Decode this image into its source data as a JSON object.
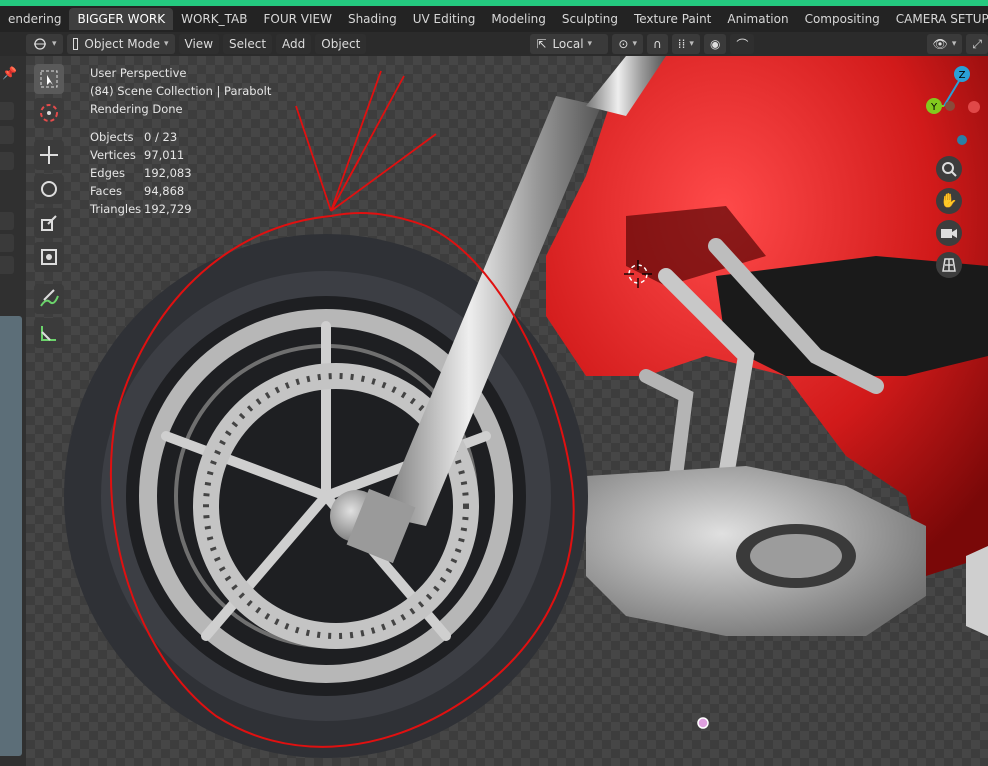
{
  "tabs": [
    "endering",
    "BIGGER WORK",
    "WORK_TAB",
    "FOUR VIEW",
    "Shading",
    "UV Editing",
    "Modeling",
    "Sculpting",
    "Texture Paint",
    "Animation",
    "Compositing",
    "CAMERA SETUP"
  ],
  "active_tab": "BIGGER WORK",
  "add_tab": "+",
  "header": {
    "mode": "Object Mode",
    "menus": [
      "View",
      "Select",
      "Add",
      "Object"
    ],
    "transform_orientation": "Local"
  },
  "viewport": {
    "view_name": "User Perspective",
    "collection": "(84) Scene Collection | Parabolt",
    "status": "Rendering Done",
    "stats": [
      {
        "label": "Objects",
        "value": "0 / 23"
      },
      {
        "label": "Vertices",
        "value": "97,011"
      },
      {
        "label": "Edges",
        "value": "192,083"
      },
      {
        "label": "Faces",
        "value": "94,868"
      },
      {
        "label": "Triangles",
        "value": "192,729"
      }
    ]
  },
  "gizmo": {
    "z_label": "Z",
    "y_label": "Y"
  },
  "icons": [
    "select-box-icon",
    "cursor-icon",
    "move-icon",
    "rotate-icon",
    "scale-icon",
    "transform-icon",
    "annotate-icon",
    "measure-icon",
    "zoom-icon",
    "pan-hand-icon",
    "camera-icon",
    "grid-view-icon"
  ],
  "colors": {
    "accent": "#24c97f",
    "bike_red": "#d61a1a",
    "annotation": "#e01010",
    "gizmo_z": "#2a9fd6",
    "gizmo_y": "#82c91e",
    "gizmo_x": "#e04848"
  }
}
